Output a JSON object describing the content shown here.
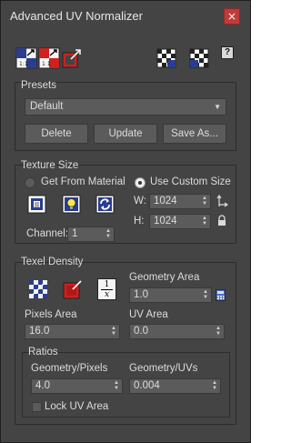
{
  "window": {
    "title": "Advanced UV Normalizer",
    "close_glyph": "×"
  },
  "toolbar": {
    "left_icons": [
      "normalize-uv-icon",
      "normalize-uv-red-icon",
      "scale-uv-icon"
    ],
    "right_icons": [
      "checker-map-icon",
      "checker-map-alt-icon"
    ],
    "help_label": "?"
  },
  "presets": {
    "title": "Presets",
    "selected": "Default",
    "delete_label": "Delete",
    "update_label": "Update",
    "save_as_label": "Save As..."
  },
  "texture_size": {
    "title": "Texture Size",
    "get_from_material_label": "Get From Material",
    "use_custom_size_label": "Use Custom Size",
    "custom_size_selected": true,
    "width_label": "W:",
    "width_value": "1024",
    "height_label": "H:",
    "height_value": "1024",
    "channel_label": "Channel:",
    "channel_value": "1",
    "icons": [
      "pick-texture-icon",
      "light-bulb-icon",
      "refresh-icon",
      "swap-size-icon",
      "lock-icon"
    ]
  },
  "texel_density": {
    "title": "Texel Density",
    "geometry_area_label": "Geometry Area",
    "geometry_area_value": "1.0",
    "pixels_area_label": "Pixels Area",
    "pixels_area_value": "16.0",
    "uv_area_label": "UV Area",
    "uv_area_value": "0.0",
    "inverse_label_num": "1",
    "inverse_label_den": "x",
    "icons": [
      "checker-icon",
      "red-checker-icon",
      "inverse-icon",
      "calculator-icon"
    ]
  },
  "ratios": {
    "title": "Ratios",
    "geometry_pixels_label": "Geometry/Pixels",
    "geometry_pixels_value": "4.0",
    "geometry_uvs_label": "Geometry/UVs",
    "geometry_uvs_value": "0.004",
    "lock_uv_area_label": "Lock UV Area",
    "lock_uv_area_checked": false
  },
  "colors": {
    "panel_bg": "#444444",
    "control_bg": "#5b5b5b",
    "text": "#dcdcdc",
    "close_red": "#c23a3a"
  }
}
